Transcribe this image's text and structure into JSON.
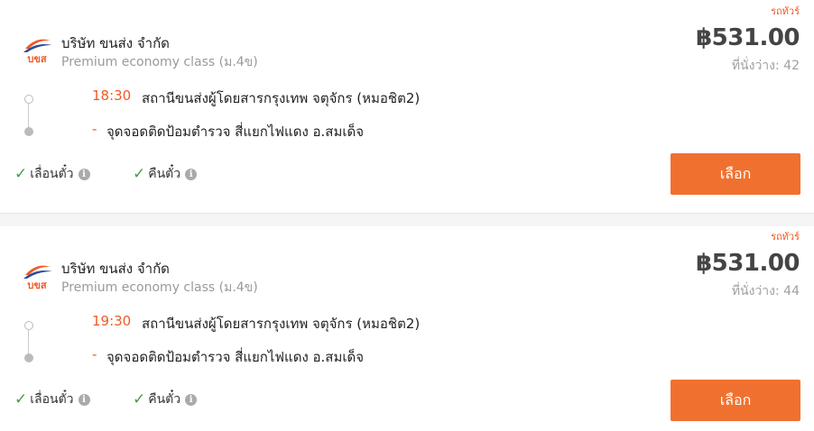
{
  "results": [
    {
      "vehicle_type": "รถทัวร์",
      "company": "บริษัท ขนส่ง จำกัด",
      "logo_text": "บขส",
      "service_class": "Premium economy class (ม.4ข)",
      "price": "฿531.00",
      "seats": "ที่นั่งว่าง: 42",
      "departure_time": "18:30",
      "departure_station": "สถานีขนส่งผู้โดยสารกรุงเทพ จตุจักร (หมอชิต2)",
      "arrival_marker": "-",
      "arrival_station": "จุดจอดติดป้อมตำรวจ สี่แยกไฟแดง อ.สมเด็จ",
      "feature_1": "เลื่อนตั๋ว",
      "feature_2": "คืนตั๋ว",
      "select_label": "เลือก"
    },
    {
      "vehicle_type": "รถทัวร์",
      "company": "บริษัท ขนส่ง จำกัด",
      "logo_text": "บขส",
      "service_class": "Premium economy class (ม.4ข)",
      "price": "฿531.00",
      "seats": "ที่นั่งว่าง: 44",
      "departure_time": "19:30",
      "departure_station": "สถานีขนส่งผู้โดยสารกรุงเทพ จตุจักร (หมอชิต2)",
      "arrival_marker": "-",
      "arrival_station": "จุดจอดติดป้อมตำรวจ สี่แยกไฟแดง อ.สมเด็จ",
      "feature_1": "เลื่อนตั๋ว",
      "feature_2": "คืนตั๋ว",
      "select_label": "เลือก"
    }
  ],
  "colors": {
    "accent": "#f05a22",
    "button": "#f0712f",
    "check": "#44a047",
    "logo_blue": "#2a4d9b"
  },
  "icons": {
    "check": "check-icon",
    "info": "info-icon",
    "logo": "bks-logo"
  }
}
